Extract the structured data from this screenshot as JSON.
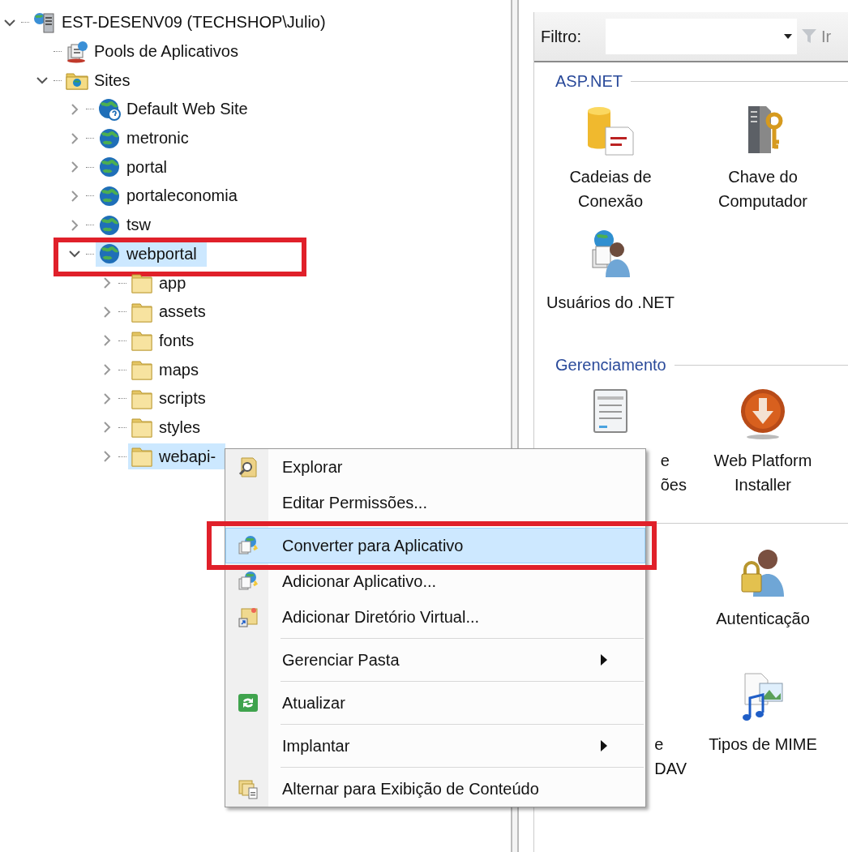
{
  "tree": [
    {
      "label": "EST-DESENV09 (TECHSHOP\\Julio)",
      "kind": "server",
      "expanded": true,
      "selected": false,
      "marked": false,
      "children": [
        {
          "label": "Pools de Aplicativos",
          "kind": "pool",
          "selected": false,
          "marked": false
        },
        {
          "label": "Sites",
          "kind": "sites",
          "expanded": true,
          "selected": false,
          "marked": false,
          "children": [
            {
              "label": "Default Web Site",
              "kind": "default-site",
              "expanded": false,
              "selected": false,
              "marked": false
            },
            {
              "label": "metronic",
              "kind": "site",
              "expanded": false,
              "selected": false,
              "marked": false
            },
            {
              "label": "portal",
              "kind": "site",
              "expanded": false,
              "selected": false,
              "marked": false
            },
            {
              "label": "portaleconomia",
              "kind": "site",
              "expanded": false,
              "selected": false,
              "marked": false
            },
            {
              "label": "tsw",
              "kind": "site",
              "expanded": false,
              "selected": false,
              "marked": false
            },
            {
              "label": "webportal",
              "kind": "site",
              "expanded": true,
              "selected": true,
              "marked": true,
              "children": [
                {
                  "label": "app",
                  "kind": "folder",
                  "expanded": false,
                  "selected": false,
                  "marked": false
                },
                {
                  "label": "assets",
                  "kind": "folder",
                  "expanded": false,
                  "selected": false,
                  "marked": false
                },
                {
                  "label": "fonts",
                  "kind": "folder",
                  "expanded": false,
                  "selected": false,
                  "marked": false
                },
                {
                  "label": "maps",
                  "kind": "folder",
                  "expanded": false,
                  "selected": false,
                  "marked": false
                },
                {
                  "label": "scripts",
                  "kind": "folder",
                  "expanded": false,
                  "selected": false,
                  "marked": false
                },
                {
                  "label": "styles",
                  "kind": "folder",
                  "expanded": false,
                  "selected": false,
                  "marked": false
                },
                {
                  "label": "webapi-",
                  "kind": "folder",
                  "expanded": false,
                  "selected": true,
                  "marked": false
                }
              ]
            }
          ]
        }
      ]
    }
  ],
  "filter": {
    "label": "Filtro:",
    "go_button": "Ir"
  },
  "groups": [
    {
      "title": "ASP.NET",
      "tiles": [
        {
          "kind": "feature",
          "lines": [
            "Cadeias de",
            "Conexão"
          ]
        },
        {
          "kind": "feature",
          "lines": [
            "Chave do",
            "Computador"
          ]
        },
        {
          "kind": "feature",
          "lines": [
            "Usuários do .NET"
          ]
        }
      ]
    },
    {
      "title": "Gerenciamento",
      "tiles": [
        {
          "kind": "clipped",
          "lines": [
            "e",
            "ões"
          ]
        },
        {
          "kind": "feature",
          "lines": [
            "Web Platform",
            "Installer"
          ]
        }
      ]
    },
    {
      "tiles": [
        {
          "kind": "covered"
        },
        {
          "kind": "feature",
          "lines": [
            "Autenticação"
          ]
        },
        {
          "kind": "clipped",
          "lines": [
            "e",
            "DAV"
          ]
        },
        {
          "kind": "feature",
          "lines": [
            "Tipos de MIME"
          ]
        }
      ]
    }
  ],
  "context_menu": {
    "items": [
      {
        "kind": "item",
        "label": "Explorar",
        "submenu": false,
        "selected": false,
        "marked": false
      },
      {
        "kind": "item",
        "label": "Editar Permissões...",
        "submenu": false,
        "selected": false,
        "marked": false
      },
      {
        "kind": "separator"
      },
      {
        "kind": "item",
        "label": "Converter para Aplicativo",
        "submenu": false,
        "selected": true,
        "marked": true
      },
      {
        "kind": "item",
        "label": "Adicionar Aplicativo...",
        "submenu": false,
        "selected": false,
        "marked": false
      },
      {
        "kind": "item",
        "label": "Adicionar Diretório Virtual...",
        "submenu": false,
        "selected": false,
        "marked": false
      },
      {
        "kind": "separator"
      },
      {
        "kind": "item",
        "label": "Gerenciar Pasta",
        "submenu": true,
        "selected": false,
        "marked": false
      },
      {
        "kind": "separator"
      },
      {
        "kind": "item",
        "label": "Atualizar",
        "submenu": false,
        "selected": false,
        "marked": false
      },
      {
        "kind": "separator"
      },
      {
        "kind": "item",
        "label": "Implantar",
        "submenu": true,
        "selected": false,
        "marked": false
      },
      {
        "kind": "separator"
      },
      {
        "kind": "item",
        "label": "Alternar para Exibição de Conteúdo",
        "submenu": false,
        "selected": false,
        "marked": false
      }
    ]
  }
}
